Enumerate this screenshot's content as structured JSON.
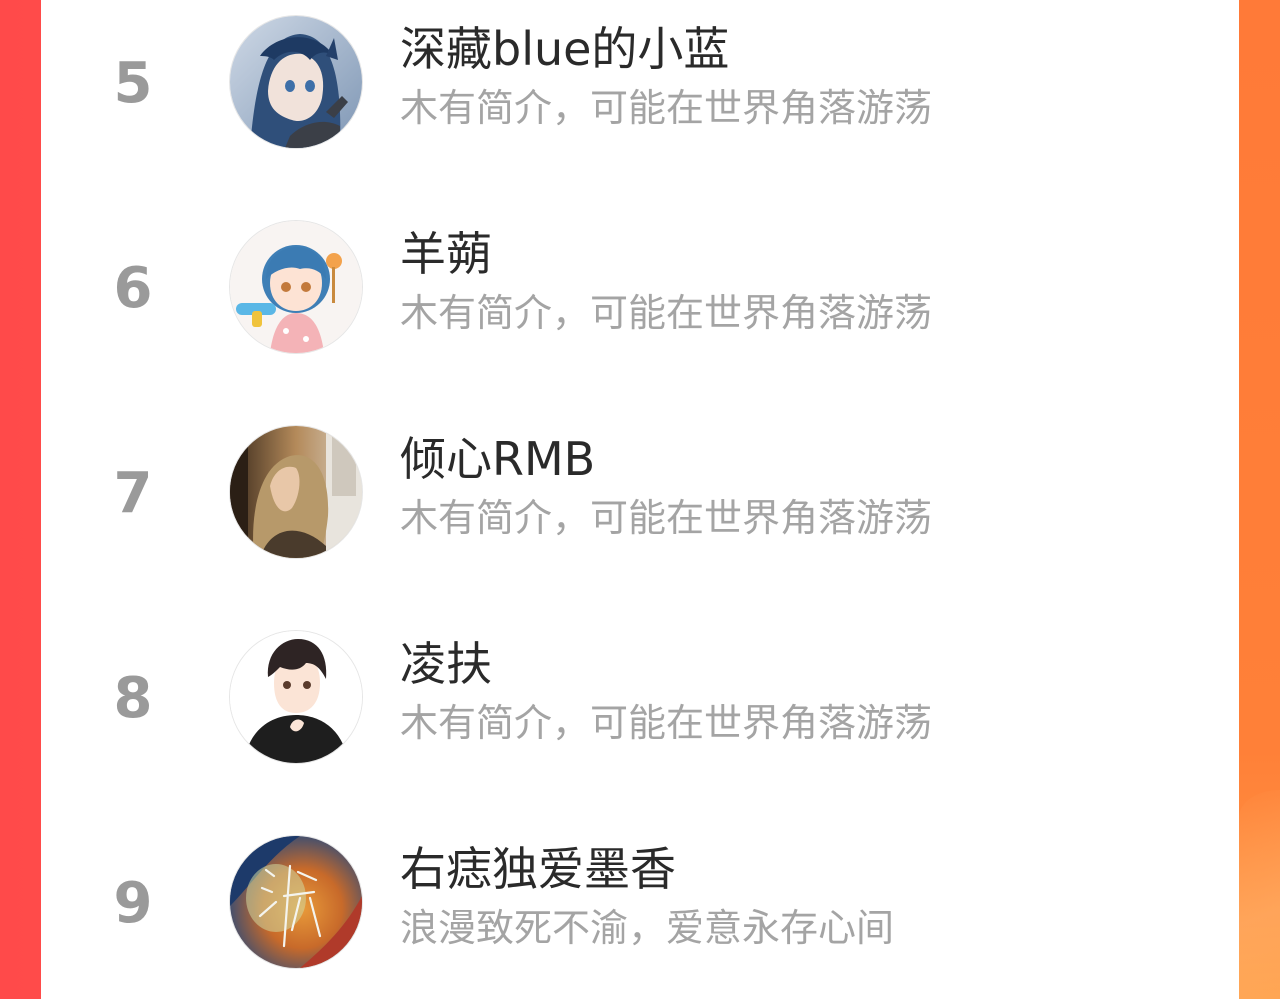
{
  "ranking": {
    "items": [
      {
        "rank": "5",
        "name": "深藏blue的小蓝",
        "bio": "木有简介，可能在世界角落游荡",
        "avatar": "anime-girl-blue-hair-avatar"
      },
      {
        "rank": "6",
        "name": "羊蒴",
        "bio": "木有简介，可能在世界角落游荡",
        "avatar": "chibi-girl-water-gun-avatar"
      },
      {
        "rank": "7",
        "name": "倾心RMB",
        "bio": "木有简介，可能在世界角落游荡",
        "avatar": "photo-girl-window-avatar"
      },
      {
        "rank": "8",
        "name": "凌扶",
        "bio": "木有简介，可能在世界角落游荡",
        "avatar": "anime-boy-black-hoodie-avatar"
      },
      {
        "rank": "9",
        "name": "右痣独爱墨香",
        "bio": "浪漫致死不渝，爱意永存心间",
        "avatar": "painted-circle-calligraphy-avatar"
      }
    ]
  },
  "colors": {
    "background_left": "#ff4a4a",
    "background_right": "#ff8a3c",
    "rank_number": "#9a9a9a",
    "name_text": "#2a2a2a",
    "bio_text": "#a4a4a4"
  }
}
